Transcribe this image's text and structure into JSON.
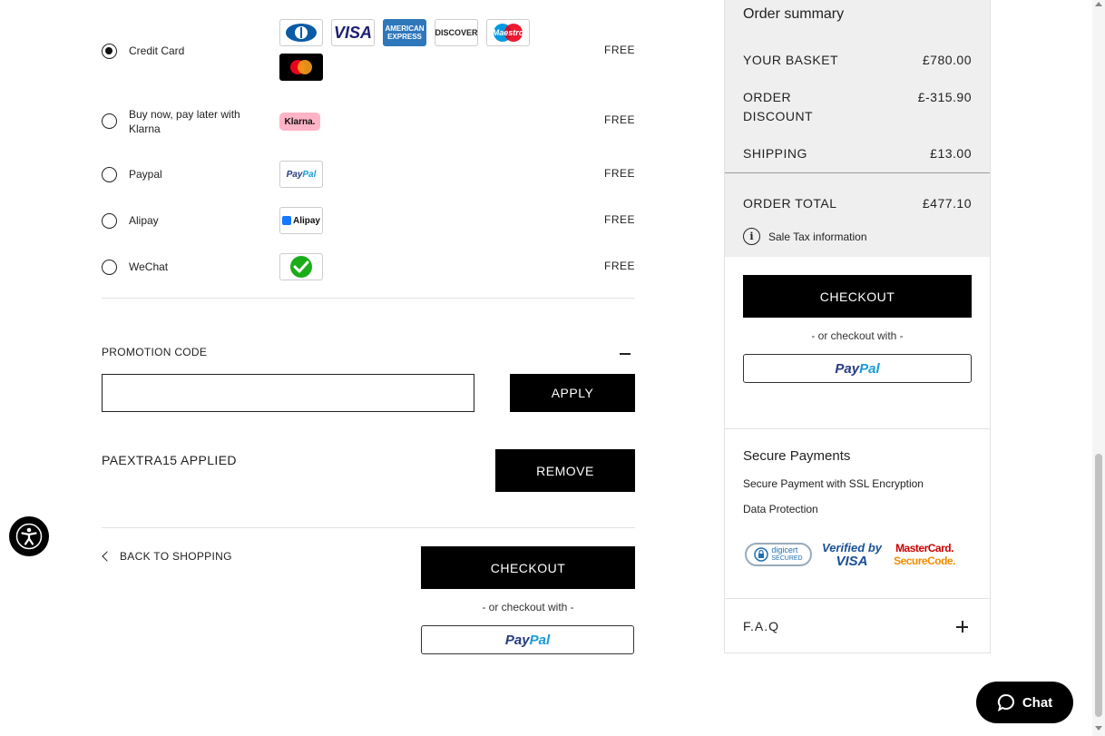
{
  "payment_methods": [
    {
      "label": "Credit Card",
      "price": "FREE",
      "selected": true
    },
    {
      "label": "Buy now, pay later with Klarna",
      "price": "FREE",
      "selected": false
    },
    {
      "label": "Paypal",
      "price": "FREE",
      "selected": false
    },
    {
      "label": "Alipay",
      "price": "FREE",
      "selected": false
    },
    {
      "label": "WeChat",
      "price": "FREE",
      "selected": false
    }
  ],
  "card_logos": {
    "visa": "VISA",
    "amex_line1": "AMERICAN",
    "amex_line2": "EXPRESS",
    "discover": "DISCOVER",
    "maestro": "Maestro",
    "klarna": "Klarna.",
    "paypal_p1": "Pay",
    "paypal_p2": "Pal",
    "alipay": "Alipay"
  },
  "promotion": {
    "title": "PROMOTION CODE",
    "input_value": "",
    "apply_label": "APPLY",
    "applied_text": "PAEXTRA15 APPLIED",
    "remove_label": "REMOVE"
  },
  "footer_actions": {
    "back_label": "BACK TO SHOPPING",
    "checkout_label": "CHECKOUT",
    "or_checkout_with": "- or checkout with -"
  },
  "paypal_button": {
    "part1": "Pay",
    "part2": "Pal"
  },
  "summary": {
    "title": "Order summary",
    "basket_label": "YOUR BASKET",
    "basket_value": "£780.00",
    "discount_label_1": "ORDER",
    "discount_label_2": "DISCOUNT",
    "discount_value": "£-315.90",
    "shipping_label": "SHIPPING",
    "shipping_value": "£13.00",
    "total_label": "ORDER TOTAL",
    "total_value": "£477.10",
    "tax_info": "Sale Tax information",
    "checkout_label": "CHECKOUT",
    "or_checkout_with": "- or checkout with -"
  },
  "secure": {
    "title": "Secure Payments",
    "line1": "Secure Payment with SSL Encryption",
    "line2": "Data Protection",
    "digicert_1": "digicert",
    "digicert_2": "SECURED",
    "visa_1": "Verified by",
    "visa_2": "VISA",
    "mc_1": "MasterCard.",
    "mc_2": "SecureCode."
  },
  "faq": {
    "label": "F.A.Q"
  },
  "chat": {
    "label": "Chat"
  },
  "colors": {
    "black": "#000000",
    "summary_bg": "#efefef",
    "paypal_dark": "#253b80",
    "paypal_light": "#179bd7",
    "klarna_pink": "#ffb3c7"
  }
}
